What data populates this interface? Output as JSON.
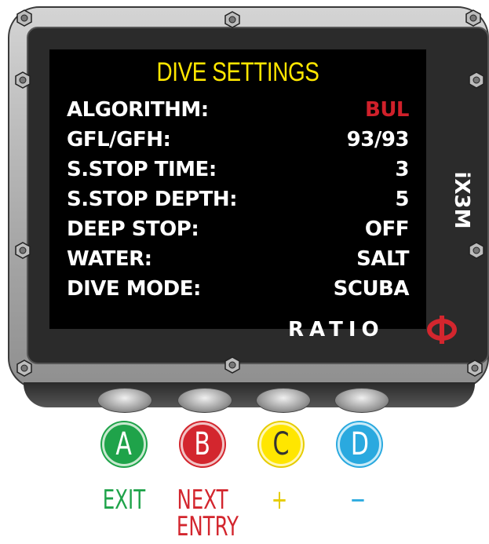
{
  "screen": {
    "title": "DIVE SETTINGS",
    "settings": [
      {
        "label": "ALGORITHM:",
        "value": "BUL",
        "value_color": "#d0202a"
      },
      {
        "label": "GFL/GFH:",
        "value": "93/93"
      },
      {
        "label": "S.STOP TIME:",
        "value": "3"
      },
      {
        "label": "S.STOP DEPTH:",
        "value": "5"
      },
      {
        "label": "DEEP STOP:",
        "value": "OFF"
      },
      {
        "label": "WATER:",
        "value": "SALT"
      },
      {
        "label": "DIVE MODE:",
        "value": "SCUBA"
      }
    ],
    "brand": "RATIO",
    "model": "iX3M"
  },
  "buttons": [
    {
      "letter": "A",
      "action": "EXIT",
      "color": "#1fa34a"
    },
    {
      "letter": "B",
      "action_line1": "NEXT",
      "action_line2": "ENTRY",
      "color": "#d3262e"
    },
    {
      "letter": "C",
      "action": "+",
      "color": "#ffe600"
    },
    {
      "letter": "D",
      "action": "−",
      "color": "#2aa9df"
    }
  ],
  "icons": {
    "logo": "ratio-phi-logo-icon",
    "screw": "hex-screw-icon"
  }
}
